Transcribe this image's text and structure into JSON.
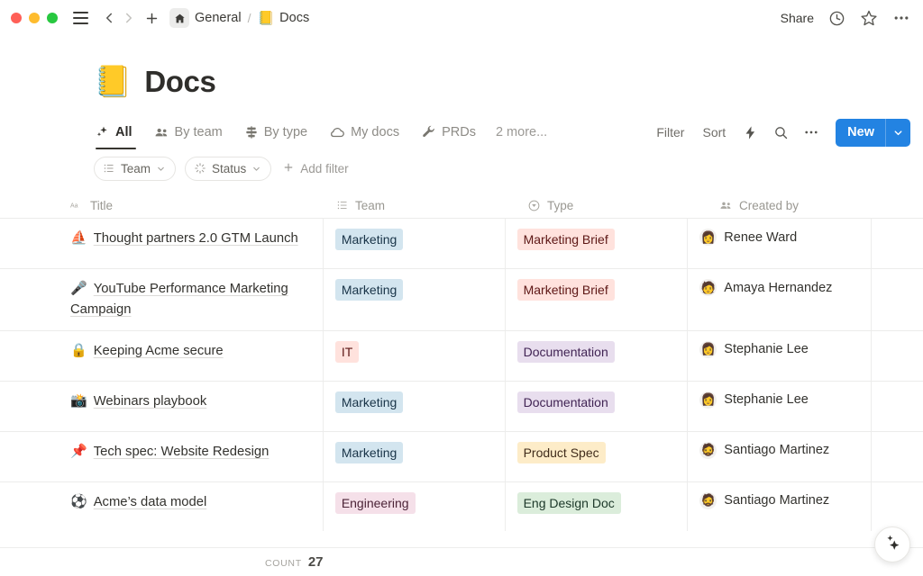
{
  "window": {
    "traffic_lights": [
      "close",
      "minimize",
      "zoom"
    ],
    "menu_icon": "hamburger-icon",
    "back_icon": "chevron-left-icon",
    "forward_icon": "chevron-right-icon",
    "new_tab_icon": "plus-icon",
    "breadcrumb": {
      "home_icon": "home-icon",
      "workspace": "General",
      "separator": "/",
      "page_emoji": "📒",
      "page": "Docs"
    },
    "actions": {
      "share": "Share",
      "history_icon": "clock-icon",
      "favorite_icon": "star-icon",
      "more_icon": "ellipsis-icon"
    }
  },
  "header": {
    "emoji": "📒",
    "title": "Docs"
  },
  "views": {
    "tabs": [
      {
        "label": "All",
        "icon": "sparkles-icon",
        "active": true
      },
      {
        "label": "By team",
        "icon": "people-icon",
        "active": false
      },
      {
        "label": "By type",
        "icon": "kanban-icon",
        "active": false
      },
      {
        "label": "My docs",
        "icon": "cloud-icon",
        "active": false
      },
      {
        "label": "PRDs",
        "icon": "wrench-icon",
        "active": false
      }
    ],
    "more_label": "2 more...",
    "actions": {
      "filter": "Filter",
      "sort": "Sort",
      "automation_icon": "lightning-icon",
      "search_icon": "search-icon",
      "more_icon": "ellipsis-icon"
    },
    "new_button": {
      "label": "New",
      "caret_icon": "chevron-down-icon",
      "color": "#2383e2"
    }
  },
  "filters": {
    "chips": [
      {
        "label": "Team",
        "icon": "list-icon",
        "caret_icon": "chevron-down-icon"
      },
      {
        "label": "Status",
        "icon": "spinner-icon",
        "caret_icon": "chevron-down-icon"
      }
    ],
    "add_filter": {
      "label": "Add filter",
      "icon": "plus-icon"
    }
  },
  "table": {
    "columns": [
      {
        "key": "title",
        "label": "Title",
        "icon": "aa-text-icon"
      },
      {
        "key": "team",
        "label": "Team",
        "icon": "list-icon"
      },
      {
        "key": "type",
        "label": "Type",
        "icon": "select-circle-icon"
      },
      {
        "key": "created_by",
        "label": "Created by",
        "icon": "people-icon"
      }
    ],
    "rows": [
      {
        "emoji": "⛵",
        "title": "Thought partners 2.0 GTM Launch",
        "team": "Marketing",
        "team_color": "blue",
        "type": "Marketing Brief",
        "type_color": "red",
        "created_by": "Renee Ward",
        "avatar": "👩"
      },
      {
        "emoji": "🎤",
        "title": "YouTube Performance Marketing Campaign",
        "team": "Marketing",
        "team_color": "blue",
        "type": "Marketing Brief",
        "type_color": "red",
        "created_by": "Amaya Hernandez",
        "avatar": "🧑"
      },
      {
        "emoji": "🔒",
        "title": "Keeping Acme secure",
        "team": "IT",
        "team_color": "red",
        "type": "Documentation",
        "type_color": "purple",
        "created_by": "Stephanie Lee",
        "avatar": "👩"
      },
      {
        "emoji": "📸",
        "title": "Webinars playbook",
        "team": "Marketing",
        "team_color": "blue",
        "type": "Documentation",
        "type_color": "purple",
        "created_by": "Stephanie Lee",
        "avatar": "👩"
      },
      {
        "emoji": "📌",
        "title": "Tech spec: Website Redesign",
        "team": "Marketing",
        "team_color": "blue",
        "type": "Product Spec",
        "type_color": "yellow",
        "created_by": "Santiago Martinez",
        "avatar": "🧔"
      },
      {
        "emoji": "⚽",
        "title": "Acme’s data model",
        "team": "Engineering",
        "team_color": "pink",
        "type": "Eng Design Doc",
        "type_color": "green",
        "created_by": "Santiago Martinez",
        "avatar": "🧔"
      }
    ]
  },
  "footer": {
    "count_label": "Count",
    "count_value": "27"
  },
  "fab": {
    "icon": "ai-sparkles-icon"
  }
}
